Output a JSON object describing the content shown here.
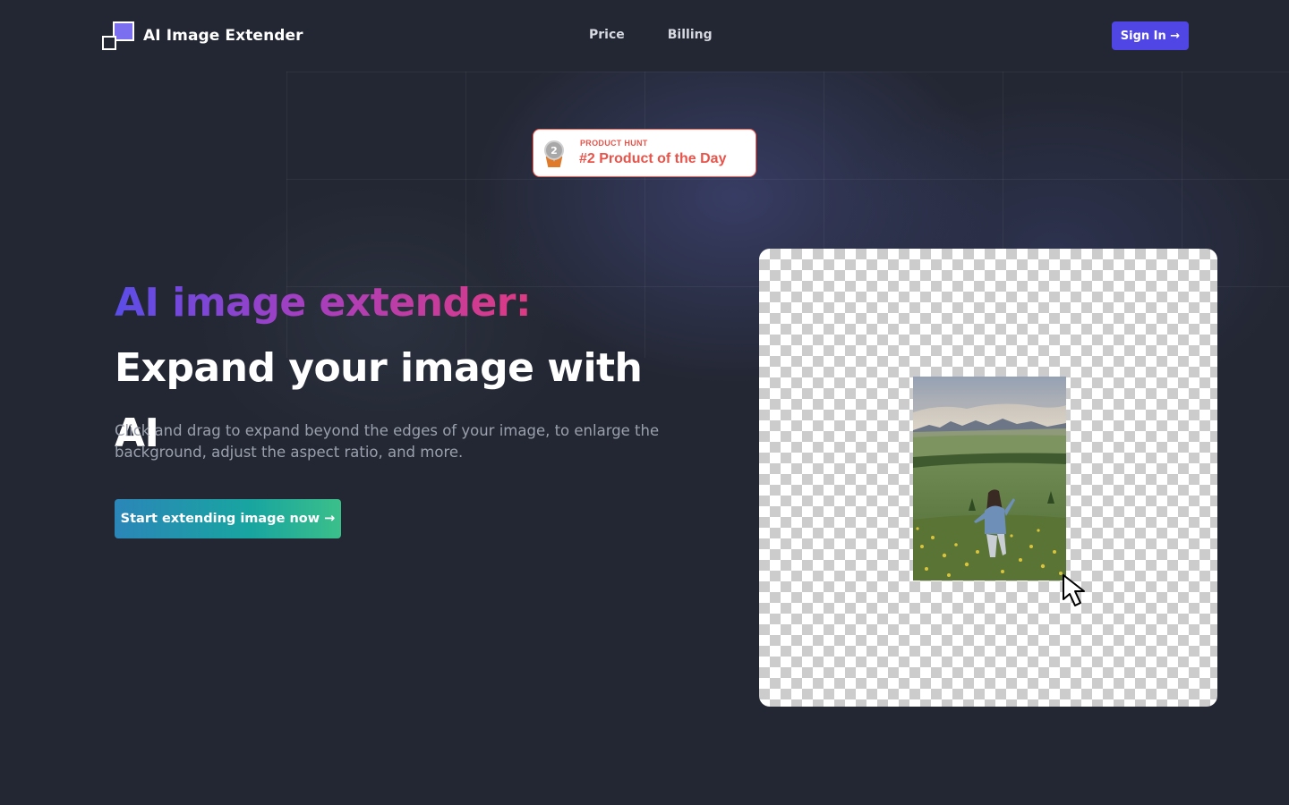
{
  "header": {
    "logo_text": "AI Image Extender",
    "nav": [
      {
        "label": "Price"
      },
      {
        "label": "Billing"
      }
    ],
    "signin_label": "Sign In →"
  },
  "badge": {
    "small": "PRODUCT HUNT",
    "big": "#2 Product of the Day",
    "medal_number": "2",
    "icon": "medal-icon"
  },
  "hero": {
    "title_highlight": "AI image extender:",
    "title_rest": " Expand your image with AI",
    "subtitle": "Click and drag to expand beyond the edges of your image, to enlarge the background, adjust the aspect ratio, and more.",
    "cta_label": "Start extending image now →"
  },
  "demo": {
    "icon": "mouse-pointer-icon"
  },
  "colors": {
    "background": "#232733",
    "accent": "#4f46e5",
    "producthunt": "#e8534a",
    "cta_start": "#2b86b8",
    "cta_end": "#3bbf8a"
  }
}
